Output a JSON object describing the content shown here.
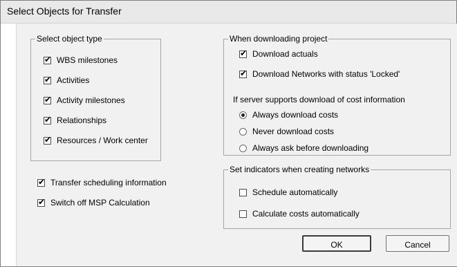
{
  "window": {
    "title": "Select Objects for Transfer"
  },
  "object_type": {
    "legend": "Select object type",
    "items": [
      {
        "label": "WBS milestones",
        "checked": true
      },
      {
        "label": "Activities",
        "checked": true
      },
      {
        "label": "Activity milestones",
        "checked": true
      },
      {
        "label": "Relationships",
        "checked": true
      },
      {
        "label": "Resources / Work center",
        "checked": true
      }
    ]
  },
  "transfer_options": [
    {
      "label": "Transfer scheduling information",
      "checked": true
    },
    {
      "label": "Switch off MSP Calculation",
      "checked": true
    }
  ],
  "download": {
    "legend": "When downloading project",
    "checkboxes": [
      {
        "label": "Download actuals",
        "checked": true
      },
      {
        "label": "Download Networks with status 'Locked'",
        "checked": true
      }
    ],
    "cost_label": "If server supports download of cost information",
    "radios": [
      {
        "label": "Always download costs",
        "selected": true
      },
      {
        "label": "Never download costs",
        "selected": false
      },
      {
        "label": "Always ask before downloading",
        "selected": false
      }
    ]
  },
  "indicators": {
    "legend": "Set indicators when creating networks",
    "items": [
      {
        "label": "Schedule automatically",
        "checked": false
      },
      {
        "label": "Calculate costs automatically",
        "checked": false
      }
    ]
  },
  "buttons": {
    "ok": "OK",
    "cancel": "Cancel"
  }
}
